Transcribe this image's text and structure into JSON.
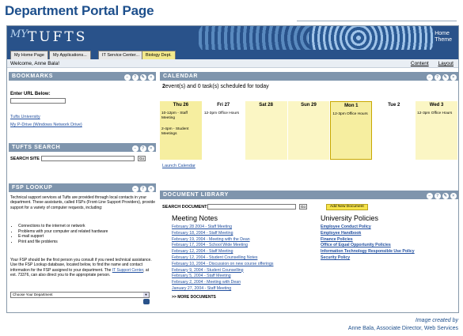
{
  "page": {
    "title": "Department Portal Page"
  },
  "banner": {
    "logo_my": "MY",
    "logo_tufts": "TUFTS",
    "home_links": [
      "Home",
      "Theme"
    ]
  },
  "tabs": [
    {
      "label": "My Home Page",
      "active": false
    },
    {
      "label": "My Applications...",
      "active": false
    },
    {
      "label": "IT Service Center...",
      "active": false
    },
    {
      "label": "Biology Dept.",
      "active": true
    }
  ],
  "welcome": {
    "text": "Welcome, Anne Bala!",
    "links": [
      "Content",
      "Layout"
    ]
  },
  "bookmarks": {
    "title": "BOOKMARKS",
    "url_label": "Enter URL Below:",
    "links": [
      "Tufts University",
      "My P-Drive (Windows Network Drive)"
    ]
  },
  "tufts_search": {
    "title": "TUFTS SEARCH",
    "label": "SEARCH SITE",
    "go": "Go"
  },
  "fsp_lookup": {
    "title": "FSP LOOKUP",
    "intro": "Technical support services at Tufts are provided through local contacts in your department. These assistants, called FSPs (Front-Line Support Providers), provide support for a variety of computer requests, including:",
    "bullets": [
      "Connections to the internet or network",
      "Problems with your computer and related hardware",
      "E-mail support",
      "Print and file problems"
    ],
    "outro_1": "Your FSP should be the first person you consult if you need technical assistance. Use the FSP Lookup database, located below, to find the name and contact information for the FSP assigned to your department. The",
    "outro_link": "IT Support Center",
    "outro_2": ", at ext. 73376, can also direct you to the appropriate person.",
    "select_value": "Choose Your Department"
  },
  "calendar": {
    "title": "CALENDAR",
    "summary_count": "2",
    "summary_text": "event(s) and 0 task(s) scheduled for today",
    "days": [
      {
        "name": "Thu 26",
        "events": [
          "10-12pm - Staff Meeting",
          "2-4pm - Student Meetings"
        ],
        "color": "#f6eea0"
      },
      {
        "name": "Fri 27",
        "events": [
          "12-3pm Office Hours"
        ],
        "color": "#ffffff"
      },
      {
        "name": "Sat 28",
        "events": [],
        "color": "#fbf6c4"
      },
      {
        "name": "Sun 29",
        "events": [],
        "color": "#fbf6c4"
      },
      {
        "name": "Mon 1",
        "events": [
          "12-3pm Office Hours"
        ],
        "color": "#f6eea0"
      },
      {
        "name": "Tue 2",
        "events": [],
        "color": "#ffffff"
      },
      {
        "name": "Wed 3",
        "events": [
          "12-3pm Office Hours"
        ],
        "color": "#fbf6c4"
      }
    ],
    "launch_link": "Launch Calendar"
  },
  "document_library": {
    "title": "DOCUMENT LIBRARY",
    "search_label": "SEARCH DOCUMENTS",
    "go": "Go",
    "add_button": "Add New Document",
    "meeting_notes_title": "Meeting Notes",
    "meeting_notes": [
      "February 28 2004 - Staff Meeting",
      "February 18, 2004 - Staff Meeting",
      "February 19, 2004 - Meeting with the Dean",
      "February 17, 2004 - School Wide Meeting",
      "February 12, 2004 - Staff Meeting",
      "February 12, 2004 - Student Counselling Notes",
      "February 10, 2004 - Discussion on new course offerings",
      "February 9, 2004 - Student Counselling",
      "February 5, 2004 - Staff Meeting",
      "February 2, 2004 - Meeting with Dean",
      "January 27, 2004 - Staff Meeting"
    ],
    "more_label": ">> MORE DOCUMENTS",
    "policies_title": "University Policies",
    "policies": [
      "Employee Conduct Policy",
      "Employee Handbook",
      "Finance Policies",
      "Office of Equal Opportunity Policies",
      "Information Technology Responsible Use Policy",
      "Security Policy"
    ]
  },
  "credit": {
    "line1": "Image created by",
    "line2": "Anne Bala, Associate Director, Web Services"
  }
}
